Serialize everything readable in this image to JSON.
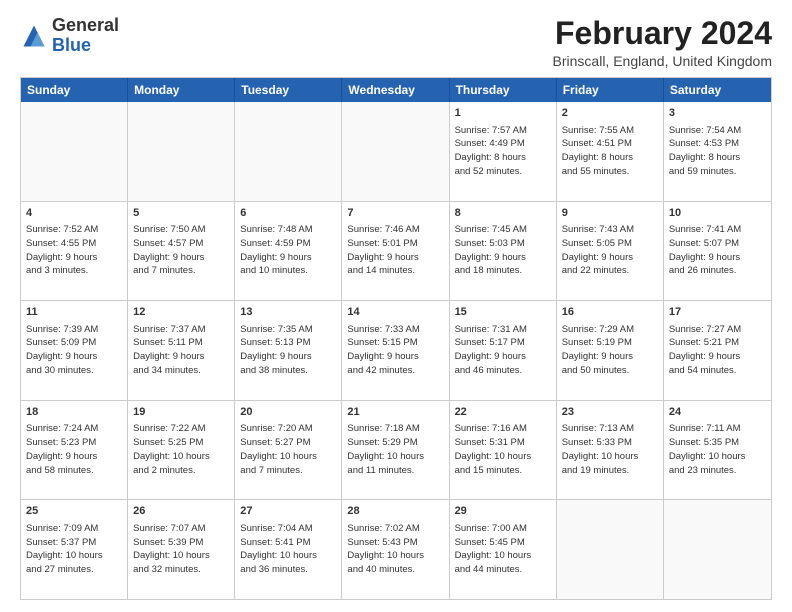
{
  "logo": {
    "general": "General",
    "blue": "Blue"
  },
  "title": "February 2024",
  "location": "Brinscall, England, United Kingdom",
  "days": [
    "Sunday",
    "Monday",
    "Tuesday",
    "Wednesday",
    "Thursday",
    "Friday",
    "Saturday"
  ],
  "weeks": [
    [
      {
        "day": "",
        "content": "",
        "empty": true
      },
      {
        "day": "",
        "content": "",
        "empty": true
      },
      {
        "day": "",
        "content": "",
        "empty": true
      },
      {
        "day": "",
        "content": "",
        "empty": true
      },
      {
        "day": "1",
        "content": "Sunrise: 7:57 AM\nSunset: 4:49 PM\nDaylight: 8 hours\nand 52 minutes."
      },
      {
        "day": "2",
        "content": "Sunrise: 7:55 AM\nSunset: 4:51 PM\nDaylight: 8 hours\nand 55 minutes."
      },
      {
        "day": "3",
        "content": "Sunrise: 7:54 AM\nSunset: 4:53 PM\nDaylight: 8 hours\nand 59 minutes."
      }
    ],
    [
      {
        "day": "4",
        "content": "Sunrise: 7:52 AM\nSunset: 4:55 PM\nDaylight: 9 hours\nand 3 minutes."
      },
      {
        "day": "5",
        "content": "Sunrise: 7:50 AM\nSunset: 4:57 PM\nDaylight: 9 hours\nand 7 minutes."
      },
      {
        "day": "6",
        "content": "Sunrise: 7:48 AM\nSunset: 4:59 PM\nDaylight: 9 hours\nand 10 minutes."
      },
      {
        "day": "7",
        "content": "Sunrise: 7:46 AM\nSunset: 5:01 PM\nDaylight: 9 hours\nand 14 minutes."
      },
      {
        "day": "8",
        "content": "Sunrise: 7:45 AM\nSunset: 5:03 PM\nDaylight: 9 hours\nand 18 minutes."
      },
      {
        "day": "9",
        "content": "Sunrise: 7:43 AM\nSunset: 5:05 PM\nDaylight: 9 hours\nand 22 minutes."
      },
      {
        "day": "10",
        "content": "Sunrise: 7:41 AM\nSunset: 5:07 PM\nDaylight: 9 hours\nand 26 minutes."
      }
    ],
    [
      {
        "day": "11",
        "content": "Sunrise: 7:39 AM\nSunset: 5:09 PM\nDaylight: 9 hours\nand 30 minutes."
      },
      {
        "day": "12",
        "content": "Sunrise: 7:37 AM\nSunset: 5:11 PM\nDaylight: 9 hours\nand 34 minutes."
      },
      {
        "day": "13",
        "content": "Sunrise: 7:35 AM\nSunset: 5:13 PM\nDaylight: 9 hours\nand 38 minutes."
      },
      {
        "day": "14",
        "content": "Sunrise: 7:33 AM\nSunset: 5:15 PM\nDaylight: 9 hours\nand 42 minutes."
      },
      {
        "day": "15",
        "content": "Sunrise: 7:31 AM\nSunset: 5:17 PM\nDaylight: 9 hours\nand 46 minutes."
      },
      {
        "day": "16",
        "content": "Sunrise: 7:29 AM\nSunset: 5:19 PM\nDaylight: 9 hours\nand 50 minutes."
      },
      {
        "day": "17",
        "content": "Sunrise: 7:27 AM\nSunset: 5:21 PM\nDaylight: 9 hours\nand 54 minutes."
      }
    ],
    [
      {
        "day": "18",
        "content": "Sunrise: 7:24 AM\nSunset: 5:23 PM\nDaylight: 9 hours\nand 58 minutes."
      },
      {
        "day": "19",
        "content": "Sunrise: 7:22 AM\nSunset: 5:25 PM\nDaylight: 10 hours\nand 2 minutes."
      },
      {
        "day": "20",
        "content": "Sunrise: 7:20 AM\nSunset: 5:27 PM\nDaylight: 10 hours\nand 7 minutes."
      },
      {
        "day": "21",
        "content": "Sunrise: 7:18 AM\nSunset: 5:29 PM\nDaylight: 10 hours\nand 11 minutes."
      },
      {
        "day": "22",
        "content": "Sunrise: 7:16 AM\nSunset: 5:31 PM\nDaylight: 10 hours\nand 15 minutes."
      },
      {
        "day": "23",
        "content": "Sunrise: 7:13 AM\nSunset: 5:33 PM\nDaylight: 10 hours\nand 19 minutes."
      },
      {
        "day": "24",
        "content": "Sunrise: 7:11 AM\nSunset: 5:35 PM\nDaylight: 10 hours\nand 23 minutes."
      }
    ],
    [
      {
        "day": "25",
        "content": "Sunrise: 7:09 AM\nSunset: 5:37 PM\nDaylight: 10 hours\nand 27 minutes."
      },
      {
        "day": "26",
        "content": "Sunrise: 7:07 AM\nSunset: 5:39 PM\nDaylight: 10 hours\nand 32 minutes."
      },
      {
        "day": "27",
        "content": "Sunrise: 7:04 AM\nSunset: 5:41 PM\nDaylight: 10 hours\nand 36 minutes."
      },
      {
        "day": "28",
        "content": "Sunrise: 7:02 AM\nSunset: 5:43 PM\nDaylight: 10 hours\nand 40 minutes."
      },
      {
        "day": "29",
        "content": "Sunrise: 7:00 AM\nSunset: 5:45 PM\nDaylight: 10 hours\nand 44 minutes."
      },
      {
        "day": "",
        "content": "",
        "empty": true
      },
      {
        "day": "",
        "content": "",
        "empty": true
      }
    ]
  ]
}
